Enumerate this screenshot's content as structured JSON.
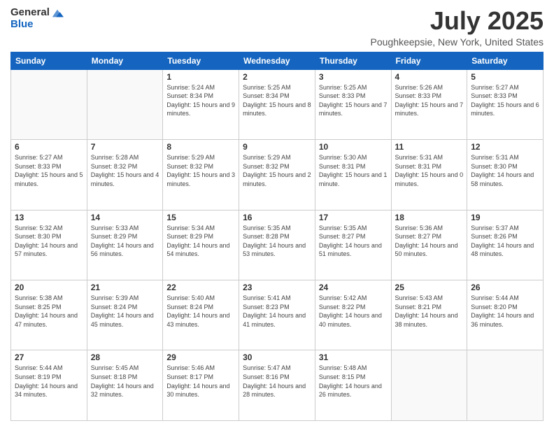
{
  "logo": {
    "general": "General",
    "blue": "Blue"
  },
  "header": {
    "month": "July 2025",
    "location": "Poughkeepsie, New York, United States"
  },
  "weekdays": [
    "Sunday",
    "Monday",
    "Tuesday",
    "Wednesday",
    "Thursday",
    "Friday",
    "Saturday"
  ],
  "weeks": [
    [
      {
        "day": "",
        "info": ""
      },
      {
        "day": "",
        "info": ""
      },
      {
        "day": "1",
        "info": "Sunrise: 5:24 AM\nSunset: 8:34 PM\nDaylight: 15 hours and 9 minutes."
      },
      {
        "day": "2",
        "info": "Sunrise: 5:25 AM\nSunset: 8:34 PM\nDaylight: 15 hours and 8 minutes."
      },
      {
        "day": "3",
        "info": "Sunrise: 5:25 AM\nSunset: 8:33 PM\nDaylight: 15 hours and 7 minutes."
      },
      {
        "day": "4",
        "info": "Sunrise: 5:26 AM\nSunset: 8:33 PM\nDaylight: 15 hours and 7 minutes."
      },
      {
        "day": "5",
        "info": "Sunrise: 5:27 AM\nSunset: 8:33 PM\nDaylight: 15 hours and 6 minutes."
      }
    ],
    [
      {
        "day": "6",
        "info": "Sunrise: 5:27 AM\nSunset: 8:33 PM\nDaylight: 15 hours and 5 minutes."
      },
      {
        "day": "7",
        "info": "Sunrise: 5:28 AM\nSunset: 8:32 PM\nDaylight: 15 hours and 4 minutes."
      },
      {
        "day": "8",
        "info": "Sunrise: 5:29 AM\nSunset: 8:32 PM\nDaylight: 15 hours and 3 minutes."
      },
      {
        "day": "9",
        "info": "Sunrise: 5:29 AM\nSunset: 8:32 PM\nDaylight: 15 hours and 2 minutes."
      },
      {
        "day": "10",
        "info": "Sunrise: 5:30 AM\nSunset: 8:31 PM\nDaylight: 15 hours and 1 minute."
      },
      {
        "day": "11",
        "info": "Sunrise: 5:31 AM\nSunset: 8:31 PM\nDaylight: 15 hours and 0 minutes."
      },
      {
        "day": "12",
        "info": "Sunrise: 5:31 AM\nSunset: 8:30 PM\nDaylight: 14 hours and 58 minutes."
      }
    ],
    [
      {
        "day": "13",
        "info": "Sunrise: 5:32 AM\nSunset: 8:30 PM\nDaylight: 14 hours and 57 minutes."
      },
      {
        "day": "14",
        "info": "Sunrise: 5:33 AM\nSunset: 8:29 PM\nDaylight: 14 hours and 56 minutes."
      },
      {
        "day": "15",
        "info": "Sunrise: 5:34 AM\nSunset: 8:29 PM\nDaylight: 14 hours and 54 minutes."
      },
      {
        "day": "16",
        "info": "Sunrise: 5:35 AM\nSunset: 8:28 PM\nDaylight: 14 hours and 53 minutes."
      },
      {
        "day": "17",
        "info": "Sunrise: 5:35 AM\nSunset: 8:27 PM\nDaylight: 14 hours and 51 minutes."
      },
      {
        "day": "18",
        "info": "Sunrise: 5:36 AM\nSunset: 8:27 PM\nDaylight: 14 hours and 50 minutes."
      },
      {
        "day": "19",
        "info": "Sunrise: 5:37 AM\nSunset: 8:26 PM\nDaylight: 14 hours and 48 minutes."
      }
    ],
    [
      {
        "day": "20",
        "info": "Sunrise: 5:38 AM\nSunset: 8:25 PM\nDaylight: 14 hours and 47 minutes."
      },
      {
        "day": "21",
        "info": "Sunrise: 5:39 AM\nSunset: 8:24 PM\nDaylight: 14 hours and 45 minutes."
      },
      {
        "day": "22",
        "info": "Sunrise: 5:40 AM\nSunset: 8:24 PM\nDaylight: 14 hours and 43 minutes."
      },
      {
        "day": "23",
        "info": "Sunrise: 5:41 AM\nSunset: 8:23 PM\nDaylight: 14 hours and 41 minutes."
      },
      {
        "day": "24",
        "info": "Sunrise: 5:42 AM\nSunset: 8:22 PM\nDaylight: 14 hours and 40 minutes."
      },
      {
        "day": "25",
        "info": "Sunrise: 5:43 AM\nSunset: 8:21 PM\nDaylight: 14 hours and 38 minutes."
      },
      {
        "day": "26",
        "info": "Sunrise: 5:44 AM\nSunset: 8:20 PM\nDaylight: 14 hours and 36 minutes."
      }
    ],
    [
      {
        "day": "27",
        "info": "Sunrise: 5:44 AM\nSunset: 8:19 PM\nDaylight: 14 hours and 34 minutes."
      },
      {
        "day": "28",
        "info": "Sunrise: 5:45 AM\nSunset: 8:18 PM\nDaylight: 14 hours and 32 minutes."
      },
      {
        "day": "29",
        "info": "Sunrise: 5:46 AM\nSunset: 8:17 PM\nDaylight: 14 hours and 30 minutes."
      },
      {
        "day": "30",
        "info": "Sunrise: 5:47 AM\nSunset: 8:16 PM\nDaylight: 14 hours and 28 minutes."
      },
      {
        "day": "31",
        "info": "Sunrise: 5:48 AM\nSunset: 8:15 PM\nDaylight: 14 hours and 26 minutes."
      },
      {
        "day": "",
        "info": ""
      },
      {
        "day": "",
        "info": ""
      }
    ]
  ]
}
